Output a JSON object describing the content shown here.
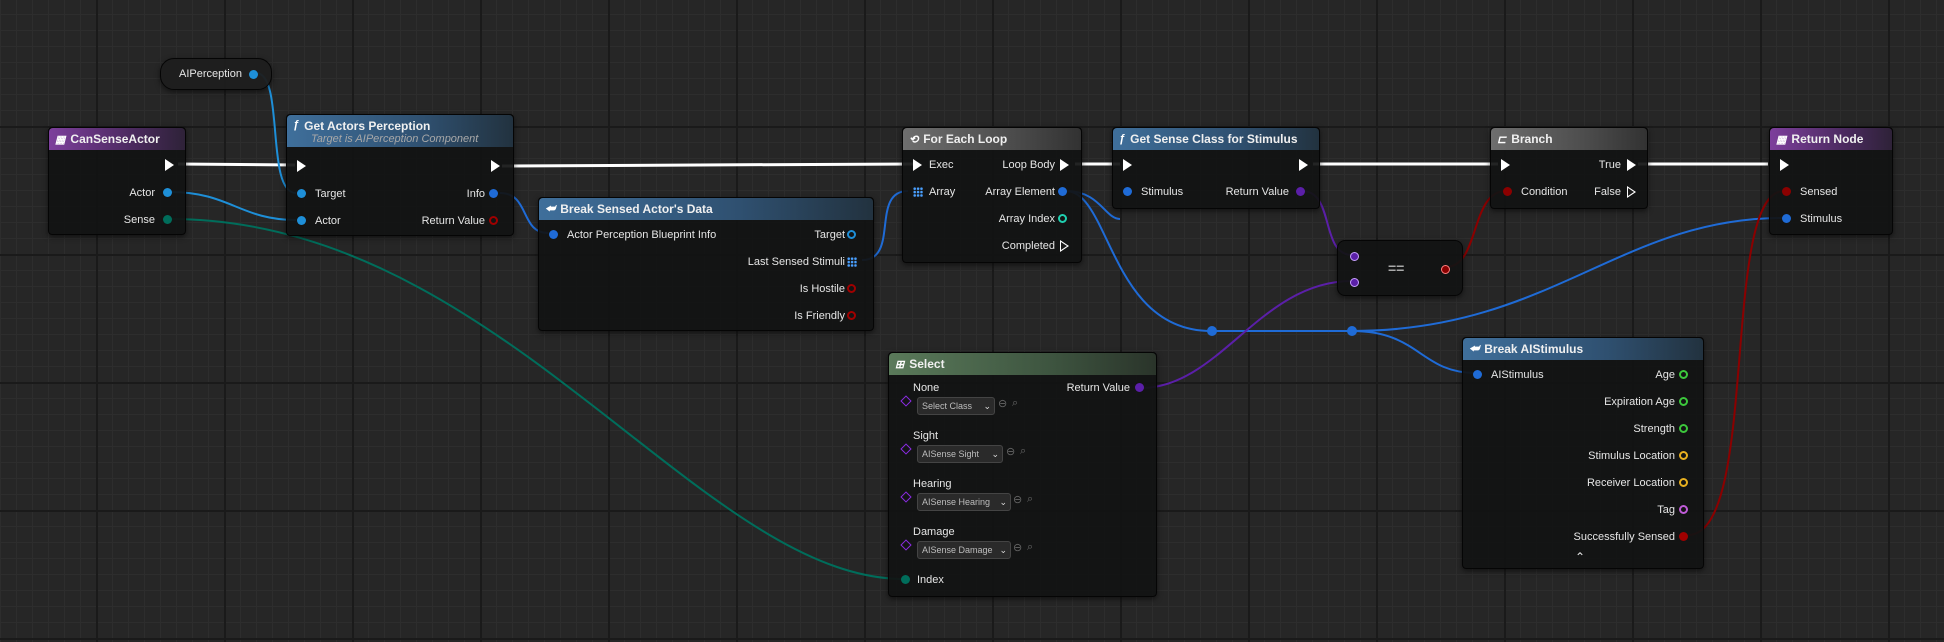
{
  "colors": {
    "exec": "#ffffff",
    "object": "#1e8fd8",
    "struct": "#1f6bd6",
    "bool": "#8b0000",
    "byte": "#006d5b",
    "class": "#7b1fd8",
    "float": "#3cc83c",
    "vector": "#e8b020",
    "name": "#c05cd8",
    "int": "#1fd0b0"
  },
  "nodes": {
    "aiperception": {
      "label": "AIPerception"
    },
    "can_sense_actor": {
      "title": "CanSenseActor",
      "pins": {
        "actor": "Actor",
        "sense": "Sense"
      }
    },
    "get_actors_perception": {
      "title": "Get Actors Perception",
      "subtitle": "Target is AIPerception Component",
      "pins": {
        "target": "Target",
        "actor": "Actor",
        "info": "Info",
        "return_value": "Return Value"
      }
    },
    "break_sensed": {
      "title": "Break Sensed Actor's Data",
      "pins": {
        "info": "Actor Perception Blueprint Info",
        "target": "Target",
        "last_stimuli": "Last Sensed Stimuli",
        "is_hostile": "Is Hostile",
        "is_friendly": "Is Friendly"
      }
    },
    "for_each": {
      "title": "For Each Loop",
      "pins": {
        "exec": "Exec",
        "array": "Array",
        "loop_body": "Loop Body",
        "array_element": "Array Element",
        "array_index": "Array Index",
        "completed": "Completed"
      }
    },
    "get_sense_class": {
      "title": "Get Sense Class for Stimulus",
      "pins": {
        "stimulus": "Stimulus",
        "return_value": "Return Value"
      }
    },
    "equals": {
      "label": "=="
    },
    "branch": {
      "title": "Branch",
      "pins": {
        "condition": "Condition",
        "true": "True",
        "false": "False"
      }
    },
    "return_node": {
      "title": "Return Node",
      "pins": {
        "sensed": "Sensed",
        "stimulus": "Stimulus"
      }
    },
    "select": {
      "title": "Select",
      "pins": {
        "return_value": "Return Value",
        "index": "Index"
      },
      "options": [
        {
          "label": "None",
          "value": "Select Class"
        },
        {
          "label": "Sight",
          "value": "AISense Sight"
        },
        {
          "label": "Hearing",
          "value": "AISense Hearing"
        },
        {
          "label": "Damage",
          "value": "AISense Damage"
        }
      ]
    },
    "break_stimulus": {
      "title": "Break AIStimulus",
      "pins": {
        "in": "AIStimulus",
        "age": "Age",
        "expiration_age": "Expiration Age",
        "strength": "Strength",
        "stimulus_location": "Stimulus Location",
        "receiver_location": "Receiver Location",
        "tag": "Tag",
        "successfully_sensed": "Successfully Sensed"
      }
    }
  }
}
